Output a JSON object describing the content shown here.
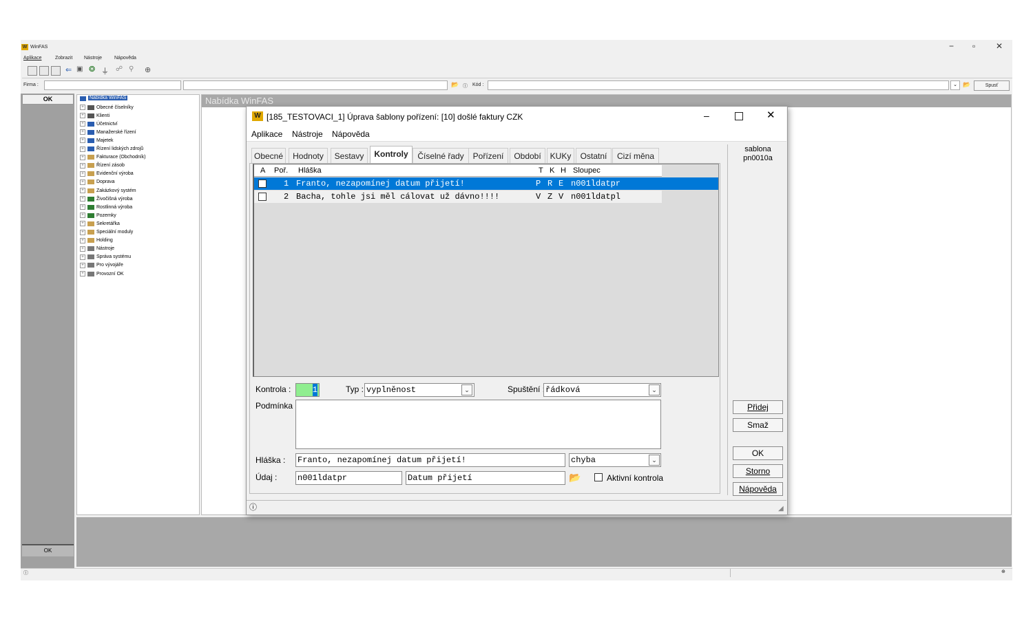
{
  "outer": {
    "title": "WinFAS",
    "menu": [
      "Aplikace",
      "Zobrazit",
      "Nástroje",
      "Nápověda"
    ],
    "firma_label": "Firma :",
    "kod_label": "Kód :",
    "spust_label": "Spusť",
    "ok_label": "OK",
    "ok_bottom_label": "OK",
    "panel_title": "Nabídka WinFAS",
    "tree_root": "Nabídka WinFAS",
    "tree": [
      {
        "label": "Obecné číselníky",
        "color": "#555555"
      },
      {
        "label": "Klienti",
        "color": "#555555"
      },
      {
        "label": "Účetnictví",
        "color": "#2a5db0"
      },
      {
        "label": "Manažerské řízení",
        "color": "#2a5db0"
      },
      {
        "label": "Majetek",
        "color": "#2a5db0"
      },
      {
        "label": "Řízení lidských zdrojů",
        "color": "#2a5db0"
      },
      {
        "label": "Fakturace (Obchodník)",
        "color": "#c8a050"
      },
      {
        "label": "Řízení zásob",
        "color": "#c8a050"
      },
      {
        "label": "Evidenční výroba",
        "color": "#c8a050"
      },
      {
        "label": "Doprava",
        "color": "#c8a050"
      },
      {
        "label": "Zakázkový systém",
        "color": "#c8a050"
      },
      {
        "label": "Živočišná výroba",
        "color": "#2e7d32"
      },
      {
        "label": "Rostlinná výroba",
        "color": "#2e7d32"
      },
      {
        "label": "Pozemky",
        "color": "#2e7d32"
      },
      {
        "label": "Sekretářka",
        "color": "#c8a050"
      },
      {
        "label": "Speciální moduly",
        "color": "#c8a050"
      },
      {
        "label": "Holding",
        "color": "#c8a050"
      },
      {
        "label": "Nástroje",
        "color": "#777777"
      },
      {
        "label": "Správa systému",
        "color": "#777777"
      },
      {
        "label": "Pro vývojáře",
        "color": "#777777"
      },
      {
        "label": "Provozní OK",
        "color": "#777777"
      }
    ]
  },
  "dialog": {
    "title": "[185_TESTOVACI_1] Úprava šablony pořízení: [10] došlé faktury CZK",
    "menu": [
      "Aplikace",
      "Nástroje",
      "Nápověda"
    ],
    "tabs": [
      "Obecné",
      "Hodnoty",
      "Sestavy",
      "Kontroly",
      "Číselné řady",
      "Pořízení",
      "Období",
      "KUKy",
      "Ostatní",
      "Cizí měna"
    ],
    "active_tab": "Kontroly",
    "template_line1": "sablona",
    "template_line2": "pn0010a",
    "grid": {
      "headers": {
        "a": "A",
        "por": "Poř.",
        "hlaska": "Hláška",
        "t": "T",
        "k": "K",
        "h": "H",
        "sloupec": "Sloupec"
      },
      "rows": [
        {
          "por": "1",
          "hlaska": "Franto, nezapomínej datum přijetí!",
          "t": "P",
          "k": "R",
          "h": "E",
          "sloupec": "n001ldatpr"
        },
        {
          "por": "2",
          "hlaska": "Bacha, tohle jsi měl cálovat už dávno!!!!",
          "t": "V",
          "k": "Z",
          "h": "V",
          "sloupec": "n001ldatpl"
        }
      ]
    },
    "form": {
      "kontrola_label": "Kontrola :",
      "kontrola_value": "1",
      "typ_label": "Typ :",
      "typ_value": "vyplněnost",
      "spusteni_label": "Spuštění :",
      "spusteni_value": "řádková",
      "podminka_label": "Podmínka :",
      "hlaska_label": "Hláška :",
      "hlaska_value": "Franto, nezapomínej datum přijetí!",
      "severity_value": "chyba",
      "udaj_label": "Údaj :",
      "udaj_value": "n001ldatpr",
      "udaj_desc": "Datum přijetí",
      "aktivni_label": "Aktivní kontrola"
    },
    "buttons": {
      "pridej": "Přidej",
      "smaz": "Smaž",
      "ok": "OK",
      "storno": "Storno",
      "napoveda": "Nápověda"
    },
    "colors": {
      "selection": "#0078d7",
      "kontrola_bg": "#90ee90",
      "header_bg": "#ffffff"
    }
  }
}
